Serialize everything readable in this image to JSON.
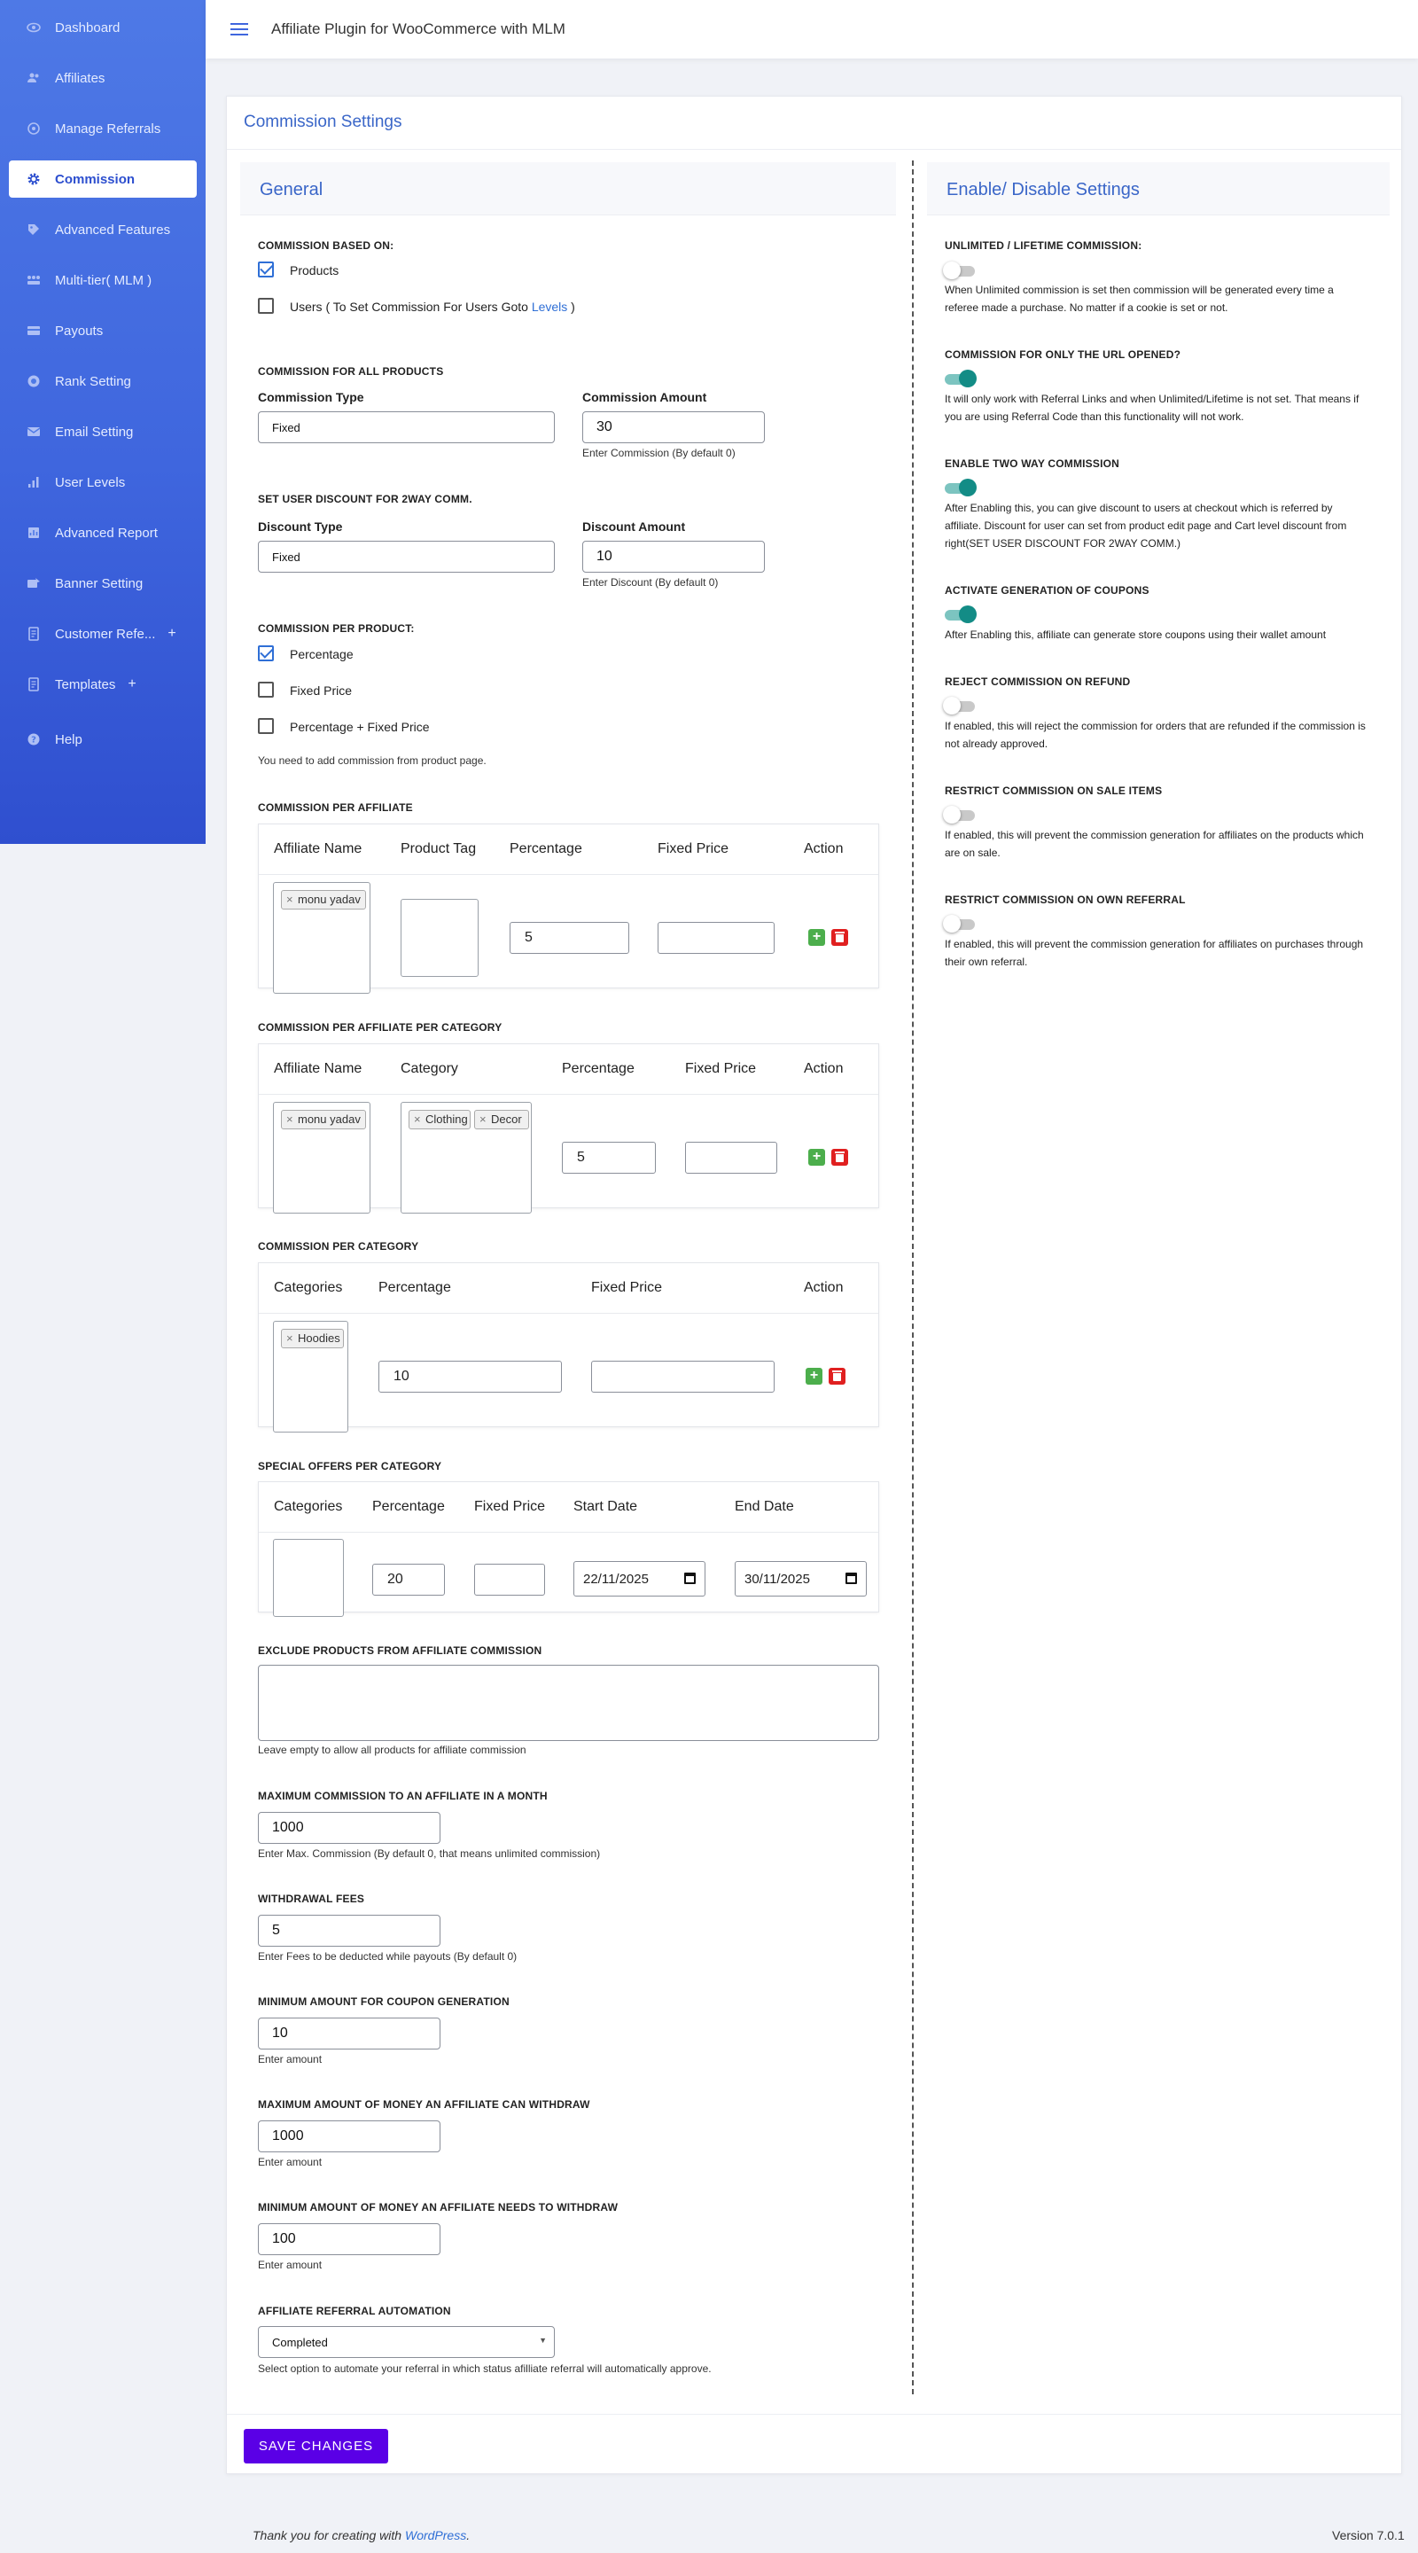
{
  "app": {
    "title": "Affiliate Plugin for WooCommerce with MLM"
  },
  "sidebar": {
    "items": [
      {
        "label": "Dashboard",
        "icon": "eye-icon"
      },
      {
        "label": "Affiliates",
        "icon": "users-icon"
      },
      {
        "label": "Manage Referrals",
        "icon": "referrals-icon"
      },
      {
        "label": "Commission",
        "icon": "gear-icon"
      },
      {
        "label": "Advanced Features",
        "icon": "features-icon"
      },
      {
        "label": "Multi-tier( MLM )",
        "icon": "network-icon"
      },
      {
        "label": "Payouts",
        "icon": "payouts-icon"
      },
      {
        "label": "Rank Setting",
        "icon": "rank-icon"
      },
      {
        "label": "Email Setting",
        "icon": "mail-icon"
      },
      {
        "label": "User Levels",
        "icon": "bars-icon"
      },
      {
        "label": "Advanced Report",
        "icon": "report-icon"
      },
      {
        "label": "Banner Setting",
        "icon": "banner-icon"
      },
      {
        "label": "Customer Refe...",
        "icon": "doc-icon",
        "plus": "+"
      },
      {
        "label": "Templates",
        "icon": "doc-icon",
        "plus": "+"
      },
      {
        "label": "Help",
        "icon": "help-icon"
      }
    ],
    "active": "Commission"
  },
  "card": {
    "title": "Commission Settings"
  },
  "general": {
    "title": "General",
    "based_on": {
      "label": "COMMISSION BASED ON:",
      "products": "Products",
      "users_prefix": "Users ( To Set Commission For Users Goto ",
      "users_link": "Levels",
      "users_suffix": " )"
    },
    "all_products": {
      "label": "COMMISSION FOR ALL PRODUCTS",
      "type_label": "Commission Type",
      "type_value": "Fixed",
      "amount_label": "Commission Amount",
      "amount_value": "30",
      "amount_help": "Enter Commission (By default 0)"
    },
    "discount": {
      "label": "SET USER DISCOUNT FOR 2WAY COMM.",
      "type_label": "Discount Type",
      "type_value": "Fixed",
      "amount_label": "Discount Amount",
      "amount_value": "10",
      "amount_help": "Enter Discount (By default 0)"
    },
    "per_product": {
      "label": "COMMISSION PER PRODUCT:",
      "percentage": "Percentage",
      "fixed": "Fixed Price",
      "both": "Percentage + Fixed Price",
      "note": "You need to add commission from product page."
    },
    "per_affiliate": {
      "label": "COMMISSION PER AFFILIATE",
      "headers": [
        "Affiliate Name",
        "Product Tag",
        "Percentage",
        "Fixed Price",
        "Action"
      ],
      "affiliate_tag": "monu yadav",
      "percentage": "5"
    },
    "per_affiliate_category": {
      "label": "COMMISSION PER AFFILIATE PER CATEGORY",
      "headers": [
        "Affiliate Name",
        "Category",
        "Percentage",
        "Fixed Price",
        "Action"
      ],
      "affiliate_tag": "monu yadav",
      "category_tags": [
        "Clothing",
        "Decor"
      ],
      "percentage": "5"
    },
    "per_category": {
      "label": "COMMISSION PER CATEGORY",
      "headers": [
        "Categories",
        "Percentage",
        "Fixed Price",
        "Action"
      ],
      "category_tag": "Hoodies",
      "percentage": "10"
    },
    "special_offers": {
      "label": "SPECIAL OFFERS PER CATEGORY",
      "headers": [
        "Categories",
        "Percentage",
        "Fixed Price",
        "Start Date",
        "End Date"
      ],
      "percentage": "20",
      "start_date": "22/11/2025",
      "end_date": "30/11/2025"
    },
    "exclude": {
      "label": "EXCLUDE PRODUCTS FROM AFFILIATE COMMISSION",
      "help": "Leave empty to allow all products for affiliate commission"
    },
    "max_commission": {
      "label": "MAXIMUM COMMISSION TO AN AFFILIATE IN A MONTH",
      "value": "1000",
      "help": "Enter Max. Commission (By default 0, that means unlimited commission)"
    },
    "withdrawal_fees": {
      "label": "WITHDRAWAL FEES",
      "value": "5",
      "help": "Enter Fees to be deducted while payouts (By default 0)"
    },
    "min_coupon": {
      "label": "MINIMUM AMOUNT FOR COUPON GENERATION",
      "value": "10",
      "help": "Enter amount"
    },
    "max_withdraw": {
      "label": "MAXIMUM AMOUNT OF MONEY AN AFFILIATE CAN WITHDRAW",
      "value": "1000",
      "help": "Enter amount"
    },
    "min_withdraw": {
      "label": "MINIMUM AMOUNT OF MONEY AN AFFILIATE NEEDS TO WITHDRAW",
      "value": "100",
      "help": "Enter amount"
    },
    "automation": {
      "label": "AFFILIATE REFERRAL AUTOMATION",
      "value": "Completed",
      "help": "Select option to automate your referral in which status afilliate referral will automatically approve."
    }
  },
  "enable": {
    "title": "Enable/ Disable Settings",
    "settings": [
      {
        "label": "UNLIMITED / LIFETIME COMMISSION:",
        "on": false,
        "desc": "When Unlimited commission is set then commission will be generated every time a referee made a purchase. No matter if a cookie is set or not."
      },
      {
        "label": "COMMISSION FOR ONLY THE URL OPENED?",
        "on": true,
        "desc": "It will only work with Referral Links and when Unlimited/Lifetime is not set. That means if you are using Referral Code than this functionality will not work."
      },
      {
        "label": "ENABLE TWO WAY COMMISSION",
        "on": true,
        "desc": "After Enabling this, you can give discount to users at checkout which is referred by affiliate. Discount for user can set from product edit page and Cart level discount from right(SET USER DISCOUNT FOR 2WAY COMM.)"
      },
      {
        "label": "ACTIVATE GENERATION OF COUPONS",
        "on": true,
        "desc": "After Enabling this, affiliate can generate store coupons using their wallet amount"
      },
      {
        "label": "REJECT COMMISSION ON REFUND",
        "on": false,
        "desc": "If enabled, this will reject the commission for orders that are refunded if the commission is not already approved."
      },
      {
        "label": "RESTRICT COMMISSION ON SALE ITEMS",
        "on": false,
        "desc": "If enabled, this will prevent the commission generation for affiliates on the products which are on sale."
      },
      {
        "label": "RESTRICT COMMISSION ON OWN REFERRAL",
        "on": false,
        "desc": "If enabled, this will prevent the commission generation for affiliates on purchases through their own referral."
      }
    ]
  },
  "save_label": "SAVE CHANGES",
  "footer": {
    "prefix": "Thank you for creating with ",
    "link": "WordPress",
    "suffix": ".",
    "version": "Version 7.0.1"
  },
  "colors": {
    "accent": "#3f66de",
    "save": "#5a00e6",
    "toggle_on": "#138c86"
  }
}
